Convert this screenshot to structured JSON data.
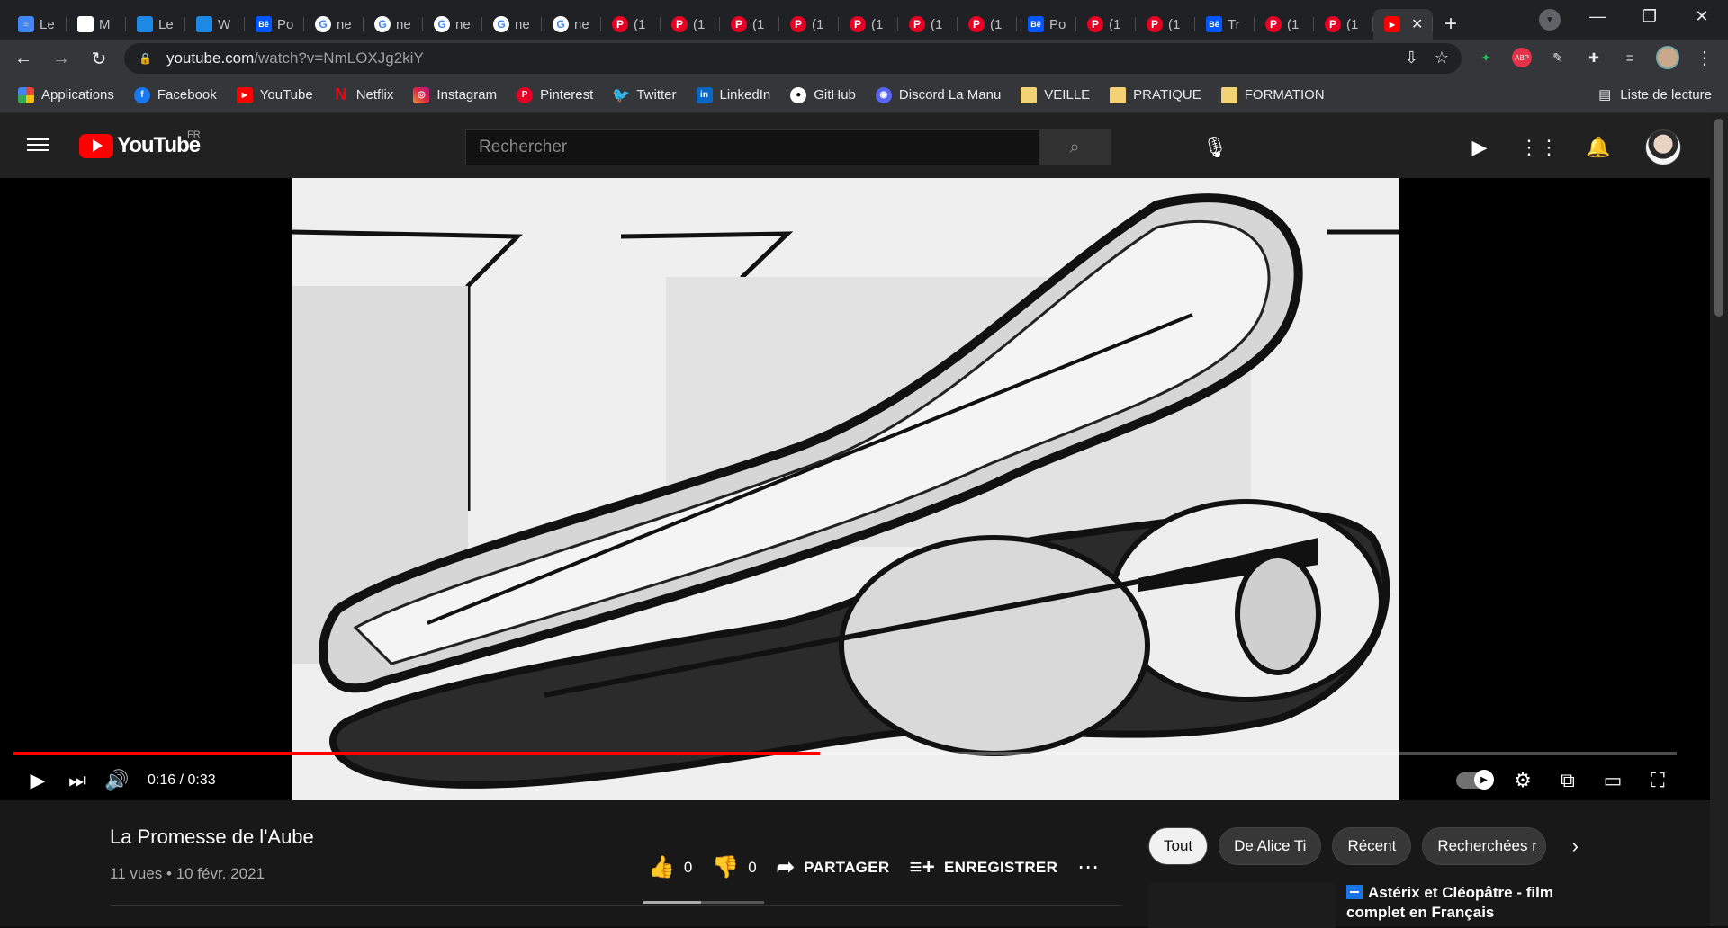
{
  "browser": {
    "tabs": [
      {
        "icon": "docs-icon",
        "label": "Le"
      },
      {
        "icon": "gmail-icon",
        "label": "M"
      },
      {
        "icon": "word-icon",
        "label": "Le"
      },
      {
        "icon": "word-icon",
        "label": "W"
      },
      {
        "icon": "behance-icon",
        "label": "Po"
      },
      {
        "icon": "google-icon",
        "label": "ne"
      },
      {
        "icon": "google-icon",
        "label": "ne"
      },
      {
        "icon": "google-icon",
        "label": "ne"
      },
      {
        "icon": "google-icon",
        "label": "ne"
      },
      {
        "icon": "google-icon",
        "label": "ne"
      },
      {
        "icon": "pinterest-icon",
        "label": "(1"
      },
      {
        "icon": "pinterest-icon",
        "label": "(1"
      },
      {
        "icon": "pinterest-icon",
        "label": "(1"
      },
      {
        "icon": "pinterest-icon",
        "label": "(1"
      },
      {
        "icon": "pinterest-icon",
        "label": "(1"
      },
      {
        "icon": "pinterest-icon",
        "label": "(1"
      },
      {
        "icon": "pinterest-icon",
        "label": "(1"
      },
      {
        "icon": "behance-icon",
        "label": "Po"
      },
      {
        "icon": "pinterest-icon",
        "label": "(1"
      },
      {
        "icon": "pinterest-icon",
        "label": "(1"
      },
      {
        "icon": "behance-icon",
        "label": "Tr"
      },
      {
        "icon": "pinterest-icon",
        "label": "(1"
      },
      {
        "icon": "pinterest-icon",
        "label": "(1"
      }
    ],
    "url_host": "youtube.com",
    "url_path": "/watch?v=NmLOXJg2kiY",
    "bookmarks": [
      {
        "icon": "apps",
        "label": "Applications"
      },
      {
        "icon": "fb",
        "label": "Facebook"
      },
      {
        "icon": "yt",
        "label": "YouTube"
      },
      {
        "icon": "nf",
        "label": "Netflix"
      },
      {
        "icon": "ig",
        "label": "Instagram"
      },
      {
        "icon": "pin",
        "label": "Pinterest"
      },
      {
        "icon": "tw",
        "label": "Twitter"
      },
      {
        "icon": "li",
        "label": "LinkedIn"
      },
      {
        "icon": "gh",
        "label": "GitHub"
      },
      {
        "icon": "dc",
        "label": "Discord La Manu"
      },
      {
        "icon": "folder",
        "label": "VEILLE"
      },
      {
        "icon": "folder",
        "label": "PRATIQUE"
      },
      {
        "icon": "folder",
        "label": "FORMATION"
      }
    ],
    "reading_list": "Liste de lecture"
  },
  "youtube": {
    "logo_text": "YouTube",
    "logo_region": "FR",
    "search_placeholder": "Rechercher",
    "player": {
      "current_time": "0:16",
      "duration": "0:33",
      "time_display": "0:16 / 0:33",
      "progress_percent": 48.5
    },
    "video": {
      "title": "La Promesse de l'Aube",
      "meta": "11 vues • 10 févr. 2021",
      "likes": "0",
      "dislikes": "0",
      "share_label": "PARTAGER",
      "save_label": "ENREGISTRER"
    },
    "chips": [
      "Tout",
      "De Alice Ti",
      "Récent",
      "Recherchées r"
    ],
    "recommendation": {
      "title": "Astérix et Cléopâtre - film complet en Français"
    }
  },
  "colors": {
    "accent": "#ff0000",
    "header_bg": "#212121",
    "page_bg": "#181818"
  }
}
